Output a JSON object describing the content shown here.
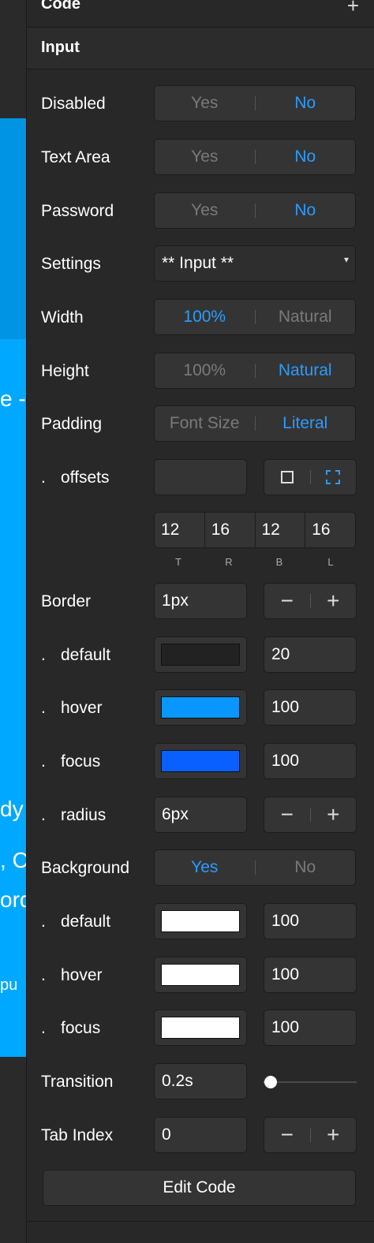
{
  "canvas": {
    "fragments": [
      "e -",
      "dy",
      ", C",
      "ord",
      "pu"
    ]
  },
  "sections": {
    "code_title": "Code",
    "code_add_icon": "plus-icon",
    "input_title": "Input"
  },
  "rows": {
    "disabled": {
      "label": "Disabled",
      "options": [
        "Yes",
        "No"
      ],
      "selected": "No"
    },
    "text_area": {
      "label": "Text Area",
      "options": [
        "Yes",
        "No"
      ],
      "selected": "No"
    },
    "password": {
      "label": "Password",
      "options": [
        "Yes",
        "No"
      ],
      "selected": "No"
    },
    "settings": {
      "label": "Settings",
      "value": "** Input **"
    },
    "width": {
      "label": "Width",
      "options": [
        "100%",
        "Natural"
      ],
      "selected": "100%"
    },
    "height": {
      "label": "Height",
      "options": [
        "100%",
        "Natural"
      ],
      "selected": "Natural"
    },
    "padding": {
      "label": "Padding",
      "options": [
        "Font Size",
        "Literal"
      ],
      "selected": "Literal"
    },
    "offsets": {
      "dot": ".",
      "label": "offsets",
      "values": [
        "12",
        "16",
        "12",
        "16"
      ],
      "sides": [
        "T",
        "R",
        "B",
        "L"
      ]
    },
    "border": {
      "label": "Border",
      "value": "1px"
    },
    "border_default": {
      "dot": ".",
      "label": "default",
      "color": "#222222",
      "opacity": "20"
    },
    "border_hover": {
      "dot": ".",
      "label": "hover",
      "color": "#0a96ff",
      "opacity": "100"
    },
    "border_focus": {
      "dot": ".",
      "label": "focus",
      "color": "#0a60ff",
      "opacity": "100"
    },
    "border_radius": {
      "dot": ".",
      "label": "radius",
      "value": "6px"
    },
    "background": {
      "label": "Background",
      "options": [
        "Yes",
        "No"
      ],
      "selected": "Yes"
    },
    "bg_default": {
      "dot": ".",
      "label": "default",
      "color": "#ffffff",
      "opacity": "100"
    },
    "bg_hover": {
      "dot": ".",
      "label": "hover",
      "color": "#ffffff",
      "opacity": "100"
    },
    "bg_focus": {
      "dot": ".",
      "label": "focus",
      "color": "#ffffff",
      "opacity": "100"
    },
    "transition": {
      "label": "Transition",
      "value": "0.2s",
      "slider_fraction": 0.08
    },
    "tab_index": {
      "label": "Tab Index",
      "value": "0"
    }
  },
  "controls": {
    "minus": "−",
    "plus": "+",
    "edit_code": "Edit Code"
  },
  "colors": {
    "accent": "#2b9cff",
    "panel_bg": "#282828",
    "canvas_blue": "#00a8ff"
  }
}
